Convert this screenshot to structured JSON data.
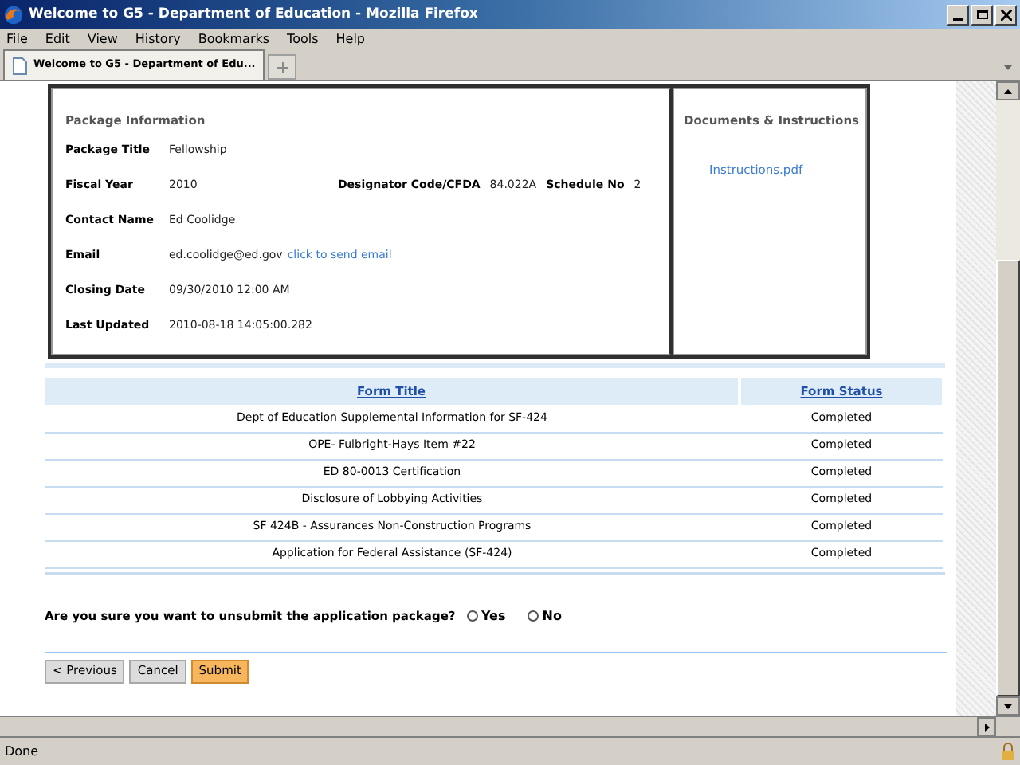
{
  "window": {
    "title": "Welcome to G5 - Department of Education - Mozilla Firefox"
  },
  "menu": [
    "File",
    "Edit",
    "View",
    "History",
    "Bookmarks",
    "Tools",
    "Help"
  ],
  "tabs": [
    {
      "label": "Welcome to G5 - Department of Edu...",
      "selected": true
    }
  ],
  "package": {
    "heading": "Package Information",
    "fields": [
      {
        "label": "Package Title",
        "value": "Fellowship"
      },
      {
        "label": "Fiscal Year",
        "value": "2010",
        "extra": [
          {
            "label": "Designator Code/CFDA",
            "value": "84.022A"
          },
          {
            "label": "Schedule No",
            "value": "2"
          }
        ]
      },
      {
        "label": "Contact Name",
        "value": "Ed Coolidge"
      },
      {
        "label": "Email",
        "value": "ed.coolidge@ed.gov",
        "link": "click to send email"
      },
      {
        "label": "Closing Date",
        "value": "09/30/2010 12:00 AM"
      },
      {
        "label": "Last Updated",
        "value": "2010-08-18 14:05:00.282"
      }
    ]
  },
  "documents": {
    "heading": "Documents & Instructions",
    "links": [
      "Instructions.pdf"
    ]
  },
  "table": {
    "columns": [
      "Form Title",
      "Form Status"
    ],
    "rows": [
      [
        "Dept of Education Supplemental Information for SF-424",
        "Completed"
      ],
      [
        "OPE- Fulbright-Hays Item #22",
        "Completed"
      ],
      [
        "ED 80-0013 Certification",
        "Completed"
      ],
      [
        "Disclosure of Lobbying Activities",
        "Completed"
      ],
      [
        "SF 424B - Assurances Non-Construction Programs",
        "Completed"
      ],
      [
        "Application for Federal Assistance (SF-424)",
        "Completed"
      ]
    ]
  },
  "question": {
    "text": "Are you sure you want to unsubmit the application package?",
    "options": [
      {
        "label": "Yes",
        "selected": false
      },
      {
        "label": "No",
        "selected": false
      }
    ]
  },
  "buttons": [
    {
      "label": "< Previous",
      "kind": "plain"
    },
    {
      "label": "Cancel",
      "kind": "plain"
    },
    {
      "label": "Submit",
      "kind": "primary"
    }
  ],
  "status_bar": "Done"
}
